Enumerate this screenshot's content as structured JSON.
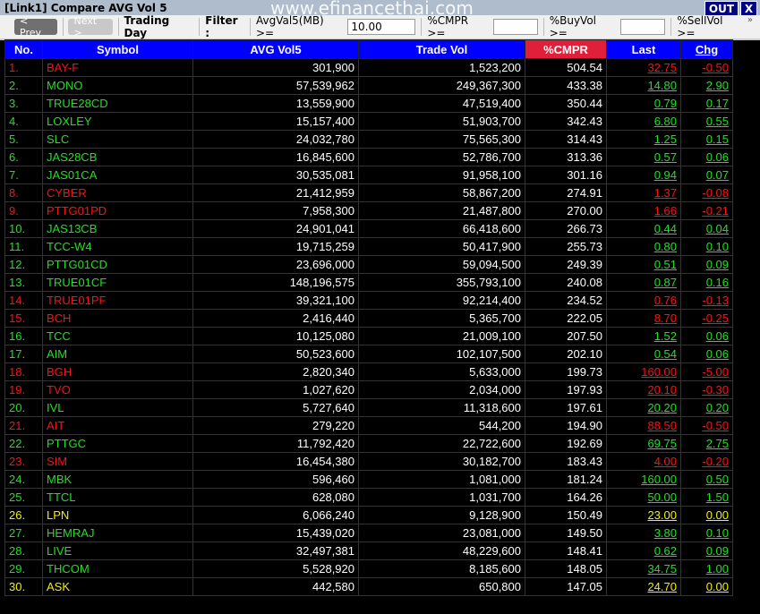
{
  "window": {
    "title": "[Link1] Compare AVG Vol 5",
    "watermark": "www.efinancethai.com",
    "out_label": "OUT",
    "close_label": "X"
  },
  "toolbar": {
    "prev": "< Prev",
    "next": "Next >",
    "trading_day": "Trading Day",
    "filter": "Filter :",
    "avgval_label": "AvgVal5(MB) >=",
    "avgval_value": "10.00",
    "cmpr_label": "%CMPR >=",
    "cmpr_value": "",
    "buyvol_label": "%BuyVol >=",
    "buyvol_value": "",
    "sellvol_label": "%SellVol >=",
    "more": "»"
  },
  "colors": {
    "header": "#0000ff",
    "sorted_header": "#e0203a",
    "up": "#20e020",
    "down": "#ff1010",
    "unchanged": "#f0f000"
  },
  "columns": [
    "No.",
    "Symbol",
    "AVG Vol5",
    "Trade Vol",
    "%CMPR",
    "Last",
    "Chg"
  ],
  "rows": [
    [
      "1.",
      "BAY-F",
      "301,900",
      "1,523,200",
      "504.54",
      "32.75",
      "-0.50",
      "red"
    ],
    [
      "2.",
      "MONO",
      "57,539,962",
      "249,367,300",
      "433.38",
      "14.80",
      "2.90",
      "green"
    ],
    [
      "3.",
      "TRUE28CD",
      "13,559,900",
      "47,519,400",
      "350.44",
      "0.79",
      "0.17",
      "green"
    ],
    [
      "4.",
      "LOXLEY",
      "15,157,400",
      "51,903,700",
      "342.43",
      "6.80",
      "0.55",
      "green"
    ],
    [
      "5.",
      "SLC",
      "24,032,780",
      "75,565,300",
      "314.43",
      "1.25",
      "0.15",
      "green"
    ],
    [
      "6.",
      "JAS28CB",
      "16,845,600",
      "52,786,700",
      "313.36",
      "0.57",
      "0.06",
      "green"
    ],
    [
      "7.",
      "JAS01CA",
      "30,535,081",
      "91,958,100",
      "301.16",
      "0.94",
      "0.07",
      "green"
    ],
    [
      "8.",
      "CYBER",
      "21,412,959",
      "58,867,200",
      "274.91",
      "1.37",
      "-0.08",
      "red"
    ],
    [
      "9.",
      "PTTG01PD",
      "7,958,300",
      "21,487,800",
      "270.00",
      "1.66",
      "-0.21",
      "red"
    ],
    [
      "10.",
      "JAS13CB",
      "24,901,041",
      "66,418,600",
      "266.73",
      "0.44",
      "0.04",
      "green"
    ],
    [
      "11.",
      "TCC-W4",
      "19,715,259",
      "50,417,900",
      "255.73",
      "0.80",
      "0.10",
      "green"
    ],
    [
      "12.",
      "PTTG01CD",
      "23,696,000",
      "59,094,500",
      "249.39",
      "0.51",
      "0.09",
      "green"
    ],
    [
      "13.",
      "TRUE01CF",
      "148,196,575",
      "355,793,100",
      "240.08",
      "0.87",
      "0.16",
      "green"
    ],
    [
      "14.",
      "TRUE01PF",
      "39,321,100",
      "92,214,400",
      "234.52",
      "0.76",
      "-0.13",
      "red"
    ],
    [
      "15.",
      "BCH",
      "2,416,440",
      "5,365,700",
      "222.05",
      "8.70",
      "-0.25",
      "red"
    ],
    [
      "16.",
      "TCC",
      "10,125,080",
      "21,009,100",
      "207.50",
      "1.52",
      "0.06",
      "green"
    ],
    [
      "17.",
      "AIM",
      "50,523,600",
      "102,107,500",
      "202.10",
      "0.54",
      "0.06",
      "green"
    ],
    [
      "18.",
      "BGH",
      "2,820,340",
      "5,633,000",
      "199.73",
      "160.00",
      "-5.00",
      "red"
    ],
    [
      "19.",
      "TVO",
      "1,027,620",
      "2,034,000",
      "197.93",
      "20.10",
      "-0.30",
      "red"
    ],
    [
      "20.",
      "IVL",
      "5,727,640",
      "11,318,600",
      "197.61",
      "20.20",
      "0.20",
      "green"
    ],
    [
      "21.",
      "AIT",
      "279,220",
      "544,200",
      "194.90",
      "88.50",
      "-0.50",
      "red"
    ],
    [
      "22.",
      "PTTGC",
      "11,792,420",
      "22,722,600",
      "192.69",
      "69.75",
      "2.75",
      "green"
    ],
    [
      "23.",
      "SIM",
      "16,454,380",
      "30,182,700",
      "183.43",
      "4.00",
      "-0.20",
      "red"
    ],
    [
      "24.",
      "MBK",
      "596,460",
      "1,081,000",
      "181.24",
      "160.00",
      "0.50",
      "green"
    ],
    [
      "25.",
      "TTCL",
      "628,080",
      "1,031,700",
      "164.26",
      "50.00",
      "1.50",
      "green"
    ],
    [
      "26.",
      "LPN",
      "6,066,240",
      "9,128,900",
      "150.49",
      "23.00",
      "0.00",
      "yellow"
    ],
    [
      "27.",
      "HEMRAJ",
      "15,439,020",
      "23,081,000",
      "149.50",
      "3.80",
      "0.10",
      "green"
    ],
    [
      "28.",
      "LIVE",
      "32,497,381",
      "48,229,600",
      "148.41",
      "0.62",
      "0.09",
      "green"
    ],
    [
      "29.",
      "THCOM",
      "5,528,920",
      "8,185,600",
      "148.05",
      "34.75",
      "1.00",
      "green"
    ],
    [
      "30.",
      "ASK",
      "442,580",
      "650,800",
      "147.05",
      "24.70",
      "0.00",
      "yellow"
    ]
  ]
}
